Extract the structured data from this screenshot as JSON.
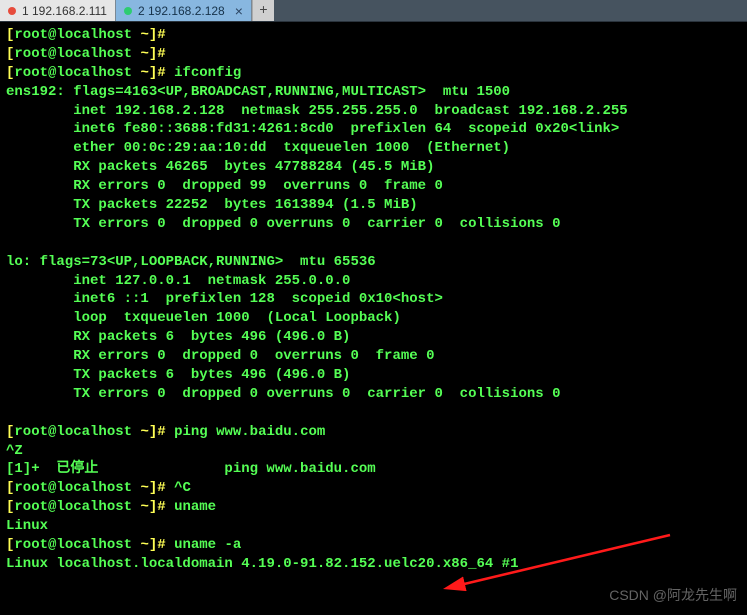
{
  "tabs": {
    "items": [
      {
        "label": "1 192.168.2.111",
        "status": "red",
        "active": false
      },
      {
        "label": "2 192.168.2.128",
        "status": "green",
        "active": true
      }
    ],
    "new_tab_label": "+"
  },
  "terminal": {
    "lines": [
      {
        "segs": [
          {
            "t": "[",
            "c": "y"
          },
          {
            "t": "root@localhost ",
            "c": "g"
          },
          {
            "t": "~",
            "c": "y"
          },
          {
            "t": "]# ",
            "c": "y"
          }
        ]
      },
      {
        "segs": [
          {
            "t": "[",
            "c": "y"
          },
          {
            "t": "root@localhost ",
            "c": "g"
          },
          {
            "t": "~",
            "c": "y"
          },
          {
            "t": "]# ",
            "c": "y"
          }
        ]
      },
      {
        "segs": [
          {
            "t": "[",
            "c": "y"
          },
          {
            "t": "root@localhost ",
            "c": "g"
          },
          {
            "t": "~",
            "c": "y"
          },
          {
            "t": "]# ",
            "c": "y"
          },
          {
            "t": "ifconfig",
            "c": "g"
          }
        ]
      },
      {
        "segs": [
          {
            "t": "ens192: flags=4163<UP,BROADCAST,RUNNING,MULTICAST>  mtu 1500",
            "c": "g"
          }
        ]
      },
      {
        "segs": [
          {
            "t": "        inet 192.168.2.128  netmask 255.255.255.0  broadcast 192.168.2.255",
            "c": "g"
          }
        ]
      },
      {
        "segs": [
          {
            "t": "        inet6 fe80::3688:fd31:4261:8cd0  prefixlen 64  scopeid 0x20<link>",
            "c": "g"
          }
        ]
      },
      {
        "segs": [
          {
            "t": "        ether 00:0c:29:aa:10:dd  txqueuelen 1000  (Ethernet)",
            "c": "g"
          }
        ]
      },
      {
        "segs": [
          {
            "t": "        RX packets 46265  bytes 47788284 (45.5 MiB)",
            "c": "g"
          }
        ]
      },
      {
        "segs": [
          {
            "t": "        RX errors 0  dropped 99  overruns 0  frame 0",
            "c": "g"
          }
        ]
      },
      {
        "segs": [
          {
            "t": "        TX packets 22252  bytes 1613894 (1.5 MiB)",
            "c": "g"
          }
        ]
      },
      {
        "segs": [
          {
            "t": "        TX errors 0  dropped 0 overruns 0  carrier 0  collisions 0",
            "c": "g"
          }
        ]
      },
      {
        "segs": [
          {
            "t": "",
            "c": "g"
          }
        ]
      },
      {
        "segs": [
          {
            "t": "lo: flags=73<UP,LOOPBACK,RUNNING>  mtu 65536",
            "c": "g"
          }
        ]
      },
      {
        "segs": [
          {
            "t": "        inet 127.0.0.1  netmask 255.0.0.0",
            "c": "g"
          }
        ]
      },
      {
        "segs": [
          {
            "t": "        inet6 ::1  prefixlen 128  scopeid 0x10<host>",
            "c": "g"
          }
        ]
      },
      {
        "segs": [
          {
            "t": "        loop  txqueuelen 1000  (Local Loopback)",
            "c": "g"
          }
        ]
      },
      {
        "segs": [
          {
            "t": "        RX packets 6  bytes 496 (496.0 B)",
            "c": "g"
          }
        ]
      },
      {
        "segs": [
          {
            "t": "        RX errors 0  dropped 0  overruns 0  frame 0",
            "c": "g"
          }
        ]
      },
      {
        "segs": [
          {
            "t": "        TX packets 6  bytes 496 (496.0 B)",
            "c": "g"
          }
        ]
      },
      {
        "segs": [
          {
            "t": "        TX errors 0  dropped 0 overruns 0  carrier 0  collisions 0",
            "c": "g"
          }
        ]
      },
      {
        "segs": [
          {
            "t": "",
            "c": "g"
          }
        ]
      },
      {
        "segs": [
          {
            "t": "[",
            "c": "y"
          },
          {
            "t": "root@localhost ",
            "c": "g"
          },
          {
            "t": "~",
            "c": "y"
          },
          {
            "t": "]# ",
            "c": "y"
          },
          {
            "t": "ping www.baidu.com",
            "c": "g"
          }
        ]
      },
      {
        "segs": [
          {
            "t": "^Z",
            "c": "g"
          }
        ]
      },
      {
        "segs": [
          {
            "t": "[1]+  已停止               ping www.baidu.com",
            "c": "g"
          }
        ]
      },
      {
        "segs": [
          {
            "t": "[",
            "c": "y"
          },
          {
            "t": "root@localhost ",
            "c": "g"
          },
          {
            "t": "~",
            "c": "y"
          },
          {
            "t": "]# ",
            "c": "y"
          },
          {
            "t": "^C",
            "c": "g"
          }
        ]
      },
      {
        "segs": [
          {
            "t": "[",
            "c": "y"
          },
          {
            "t": "root@localhost ",
            "c": "g"
          },
          {
            "t": "~",
            "c": "y"
          },
          {
            "t": "]# ",
            "c": "y"
          },
          {
            "t": "uname",
            "c": "g"
          }
        ]
      },
      {
        "segs": [
          {
            "t": "Linux",
            "c": "g"
          }
        ]
      },
      {
        "segs": [
          {
            "t": "[",
            "c": "y"
          },
          {
            "t": "root@localhost ",
            "c": "g"
          },
          {
            "t": "~",
            "c": "y"
          },
          {
            "t": "]# ",
            "c": "y"
          },
          {
            "t": "uname -a",
            "c": "g"
          }
        ]
      },
      {
        "segs": [
          {
            "t": "Linux localhost.localdomain 4.19.0-91.82.152.uelc20.x86_64 #1",
            "c": "g"
          }
        ]
      }
    ]
  },
  "watermark": "CSDN @阿龙先生啊"
}
